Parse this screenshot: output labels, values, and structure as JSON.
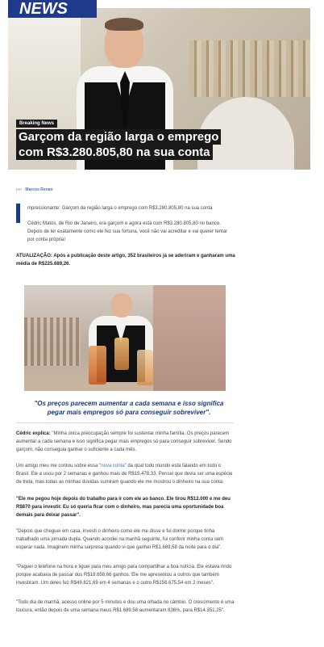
{
  "logo": "NEWS",
  "hero": {
    "badge": "Breaking News",
    "headline_line1": "Garçom da região larga o emprego",
    "headline_line2": "com R$3.280.805,80 na sua conta"
  },
  "byline": {
    "prefix": "por",
    "author": "Marcos Renan"
  },
  "intro": {
    "line1": "mpressionante: Garçom da região larga o emprego com R$3.280.805,80 na sua conta",
    "line2": "Cédric Matos, de Rio de Janeiro, era garçom e agora está com R$3.280.805,80 no banco. Depois de ler exatamente como ele fez sua fortuna, você não vai acreditar e vai querer tentar por conta própria!"
  },
  "update": "ATUALIZAÇÃO: Após a publicação deste artigo, 352 brasileiros já se aderiram e ganharam uma média de R$225.689,26.",
  "quote": "\"Os preços parecem aumentar a cada semana e isso significa pegar mais empregos só para conseguir sobreviver\".",
  "body": {
    "p1_label": "Cédric explica:",
    "p1": " \"Minha única preocupação sempre foi sustentar minha família. Os preços parecem aumentar a cada semana e isso significa pegar mais empregos só para conseguir sobreviver. Sendo garçom, não conseguia ganhar o suficiente a cada mês.",
    "p2_a": "Um amigo meu me contou sobre essa \"",
    "p2_link": "nova conta",
    "p2_b": "\" da qual todo mundo está falando em todo o Brasil. Ele a usou por 2 semanas e ganhou mais de R$15.478,33. Pensei que devia ser uma espécie de treta, mas todas as minhas dúvidas sumiram quando ele me mostrou o dinheiro na sua conta.",
    "p3": "\"Ele me pegou hoje depois do trabalho para ir com ele ao banco. Ele tirou R$12.000 e me deu R$870 para investir. Eu só queria ficar com o dinheiro, mas parecia uma oportunidade boa demais para deixar passar\".",
    "p4": "\"Depois que cheguei em casa, investi o dinheiro como ele me disse e fui dormir porque tinha trabalhado uma jornada dupla. Quando acordei na manhã seguinte, fui conferir minha conta sem esperar nada. Imaginem minha surpresa quando vi que ganhei R$1.689,58 da noite para o dia\".",
    "p5": "\"Paguei o telefone na hora e liguei para meu amigo para compartilhar a boa notícia. Ele estava rindo porque acabava de passar dos R$18.658,66 ganhos. Ele me apresentou a outros que também investiram. Um deles fez R$49.821,69 em 4 semanas e o outro R$156.675,54 em 2 meses\".",
    "p6": "\"Todo dia de manhã, acesso online por 5 minutos e dou uma olhada no câmbio. O crescimento é uma loucura, então depois de uma semana meus R$1.689,58 aumentaram 836%, para R$14.351,25\"."
  }
}
